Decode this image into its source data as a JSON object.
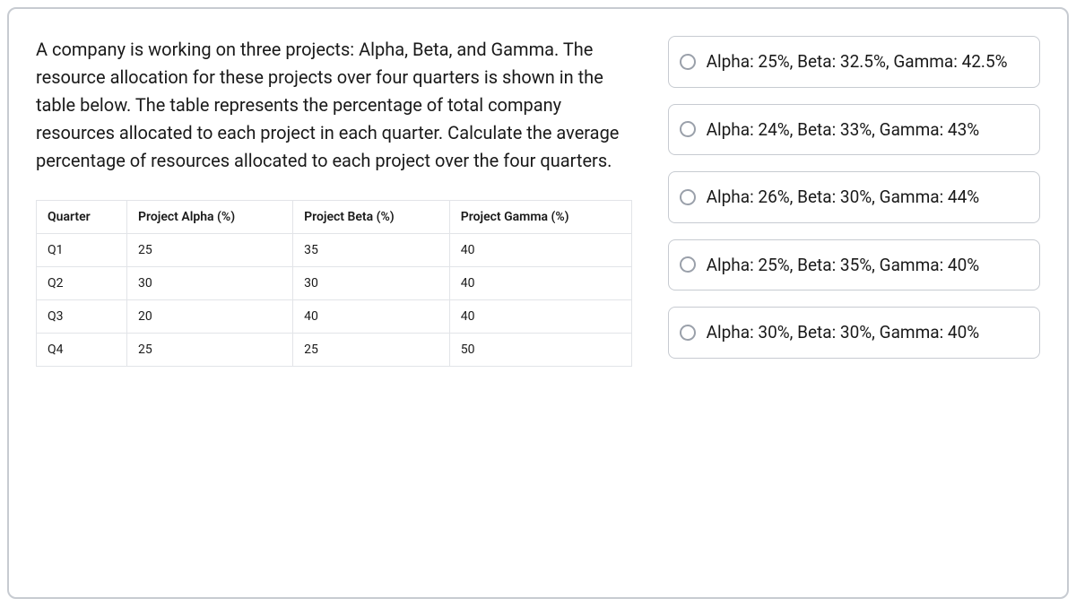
{
  "question": "A company is working on three projects: Alpha, Beta, and Gamma. The resource allocation for these projects over four quarters is shown in the table below. The table represents the percentage of total company resources allocated to each project in each quarter. Calculate the average percentage of resources allocated to each project over the four quarters.",
  "table": {
    "headers": [
      "Quarter",
      "Project Alpha (%)",
      "Project Beta (%)",
      "Project Gamma (%)"
    ],
    "rows": [
      [
        "Q1",
        "25",
        "35",
        "40"
      ],
      [
        "Q2",
        "30",
        "30",
        "40"
      ],
      [
        "Q3",
        "20",
        "40",
        "40"
      ],
      [
        "Q4",
        "25",
        "25",
        "50"
      ]
    ]
  },
  "options": [
    "Alpha: 25%, Beta: 32.5%, Gamma: 42.5%",
    "Alpha: 24%, Beta: 33%, Gamma: 43%",
    "Alpha: 26%, Beta: 30%, Gamma: 44%",
    "Alpha: 25%, Beta: 35%, Gamma: 40%",
    "Alpha: 30%, Beta: 30%, Gamma: 40%"
  ]
}
